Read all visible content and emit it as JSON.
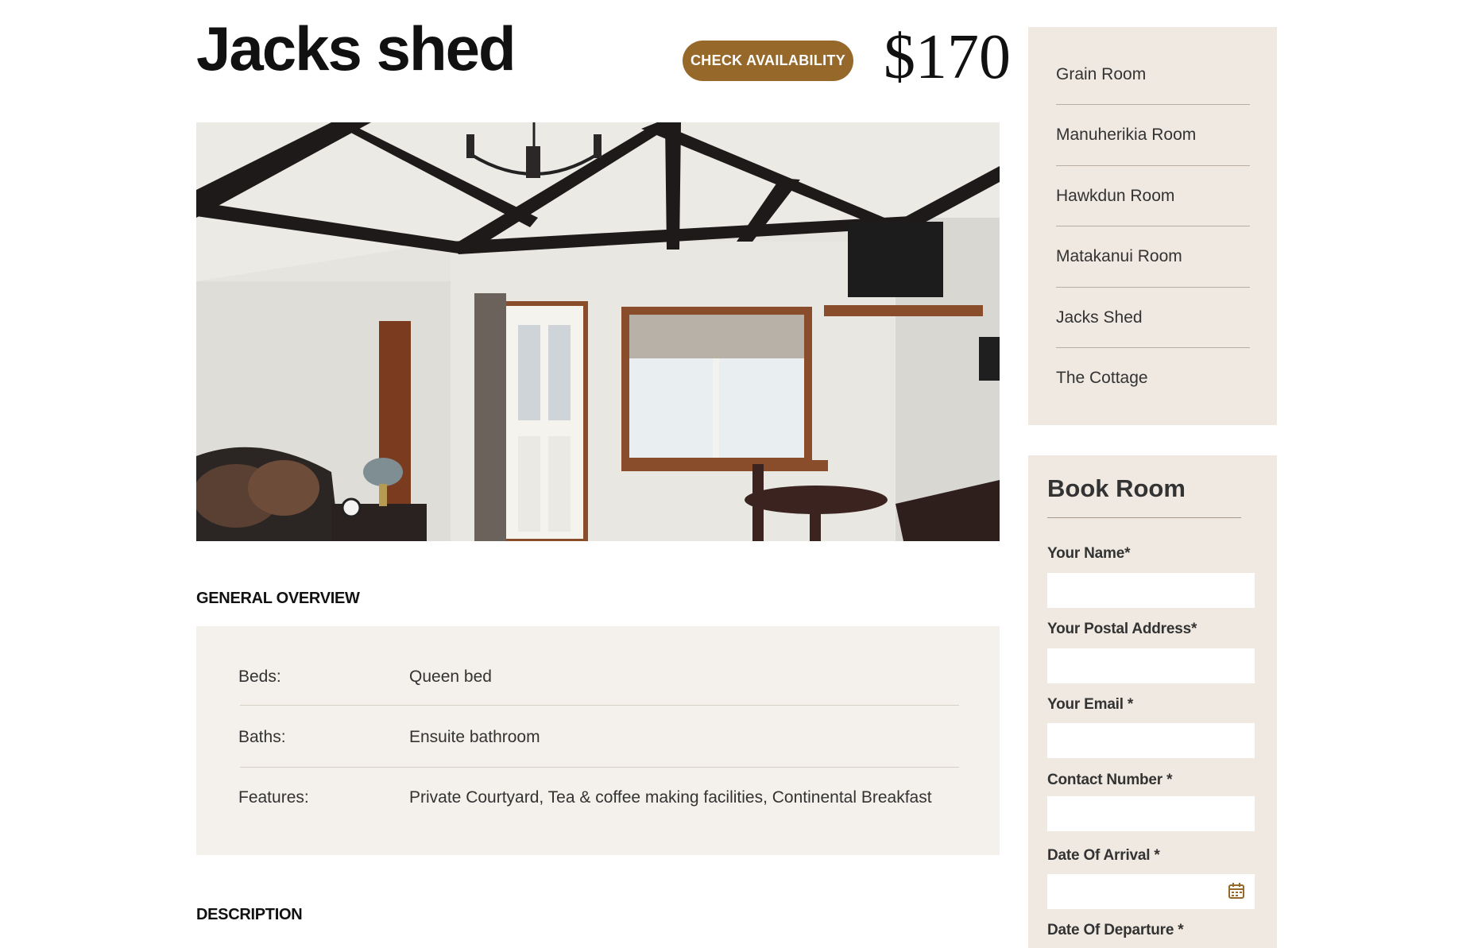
{
  "header": {
    "title": "Jacks shed",
    "check_availability_label": "CHECK AVAILABILITY",
    "price": "$170"
  },
  "overview": {
    "heading": "GENERAL OVERVIEW",
    "rows": [
      {
        "label": "Beds:",
        "value": "Queen bed"
      },
      {
        "label": "Baths:",
        "value": "Ensuite bathroom"
      },
      {
        "label": "Features:",
        "value": "Private Courtyard, Tea & coffee making facilities, Continental Breakfast"
      }
    ]
  },
  "description": {
    "heading": "DESCRIPTION"
  },
  "rooms": {
    "items": [
      "Grain Room",
      "Manuherikia Room",
      "Hawkdun Room",
      "Matakanui Room",
      "Jacks Shed",
      "The Cottage"
    ]
  },
  "booking": {
    "title": "Book Room",
    "fields": [
      {
        "label": "Your Name*",
        "value": ""
      },
      {
        "label": "Your Postal Address*",
        "value": ""
      },
      {
        "label": "Your Email *",
        "value": ""
      },
      {
        "label": "Contact Number *",
        "value": ""
      },
      {
        "label": "Date Of Arrival *",
        "value": ""
      },
      {
        "label": "Date Of Departure *",
        "value": ""
      }
    ]
  },
  "colors": {
    "accent": "#96692a",
    "panel": "#efe9e2",
    "overview_bg": "#f4f1ec"
  },
  "icons": {
    "calendar": "calendar-icon"
  }
}
